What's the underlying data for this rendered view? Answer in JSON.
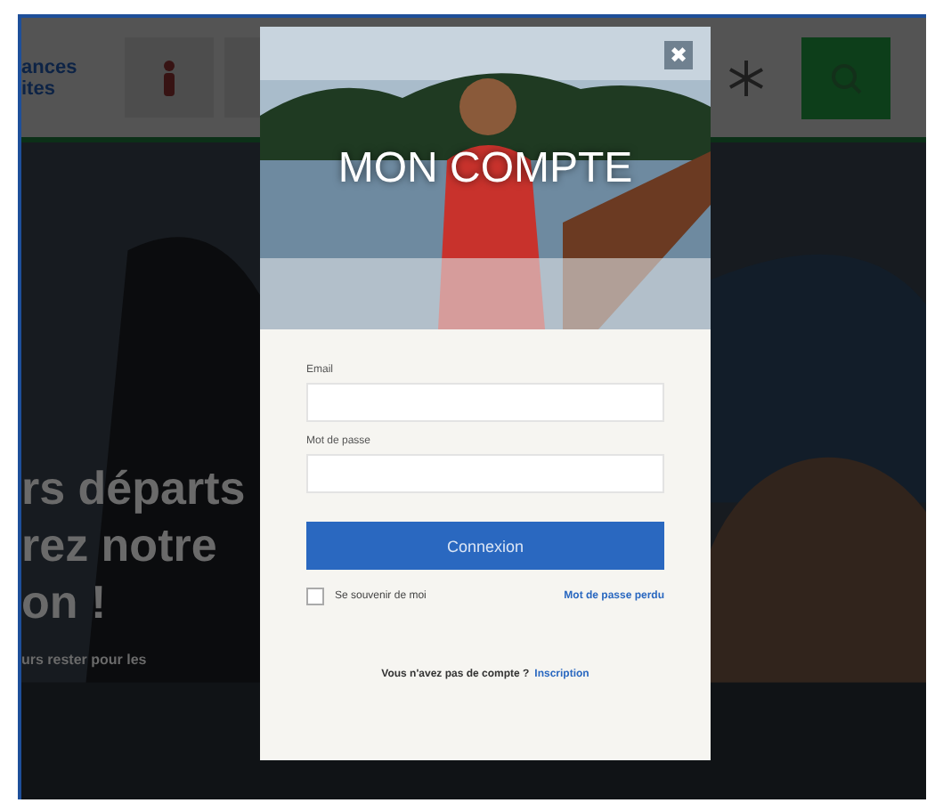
{
  "header": {
    "logo_lines": [
      "ances",
      "ites"
    ]
  },
  "hero": {
    "lines": [
      "rs départs",
      "rez notre",
      "on !"
    ],
    "subtitle": "urs rester pour les"
  },
  "modal": {
    "title": "MON COMPTE",
    "close": "✖",
    "fields": [
      {
        "label": "Email"
      },
      {
        "label": "Mot de passe"
      }
    ],
    "submit": "Connexion",
    "remember": {
      "label": "Se souvenir de moi",
      "checked": false
    },
    "forgot": "Mot de passe perdu",
    "signup_text": "Vous n'avez pas de compte ?",
    "signup_link": "Inscription"
  }
}
